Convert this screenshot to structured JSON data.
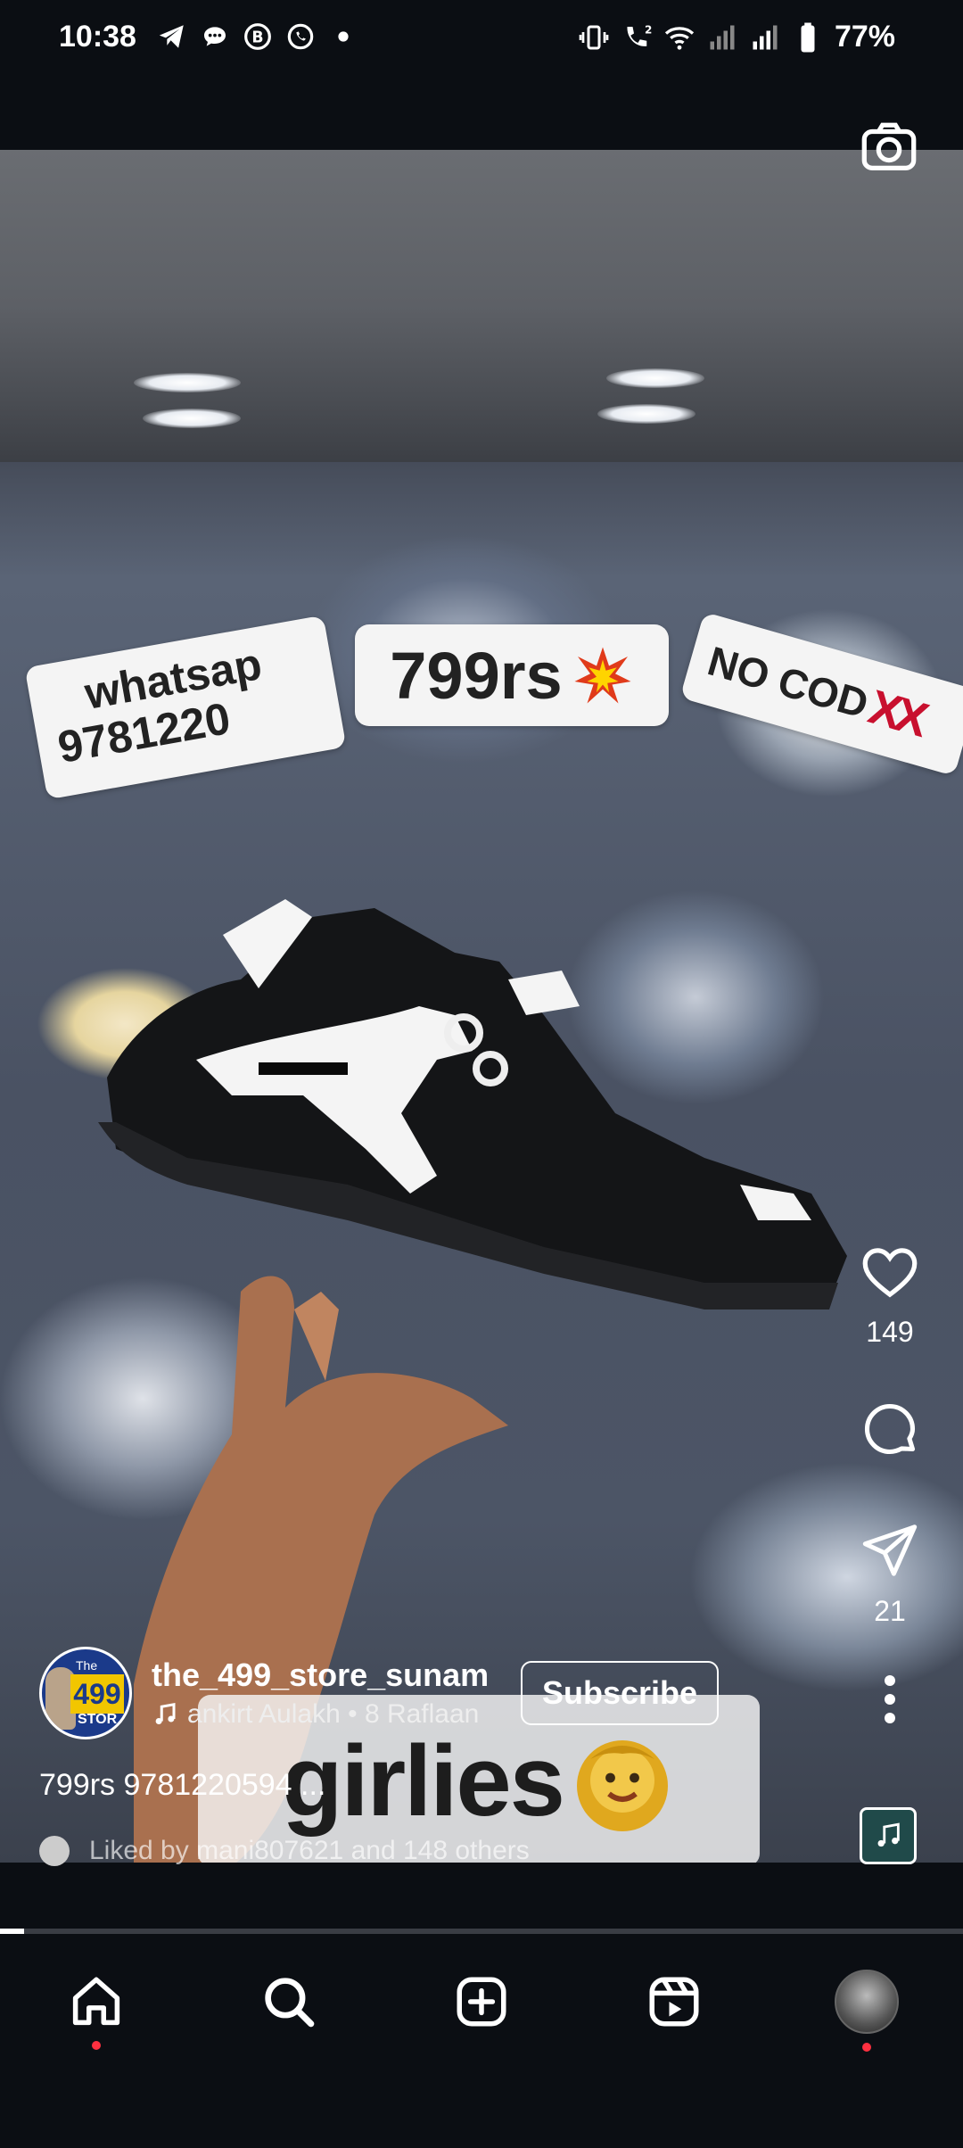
{
  "status_bar": {
    "time": "10:38",
    "battery": "77%",
    "left_icons": [
      "telegram-icon",
      "chat-bubble-icon",
      "b-message-icon",
      "whatsapp-icon",
      "notification-dot-icon"
    ],
    "right_icons": [
      "vibrate-icon",
      "wifi-calling-icon",
      "wifi-icon",
      "signal-weak-icon",
      "signal-icon",
      "battery-icon"
    ]
  },
  "reel": {
    "stickers": {
      "whatsapp_line1": "whatsap",
      "whatsapp_line2": "9781220",
      "price": "799rs",
      "no_cod": "NO COD",
      "no_cod_marks": "XX",
      "caption_overlay": "girlies"
    },
    "likes_count": "149",
    "shares_count": "21",
    "author": {
      "username": "the_499_store_sunam",
      "avatar_badge": "499",
      "avatar_small1": "The",
      "avatar_small2": "STOR"
    },
    "subscribe_label": "Subscribe",
    "audio": "ankirt Aulakh • 8 Raflaan",
    "caption": "799rs 9781220594 ...",
    "liked_by": {
      "prefix": "Liked by",
      "user": "mani807621",
      "middle": "and",
      "others": "148 others"
    },
    "progress": 0.025
  },
  "nav": {
    "items": [
      "home-icon",
      "search-icon",
      "create-icon",
      "reels-icon",
      "profile-avatar"
    ]
  },
  "colors": {
    "background": "#0b0e13",
    "accent_red": "#ff3040",
    "no_cod_red": "#c8102e"
  }
}
